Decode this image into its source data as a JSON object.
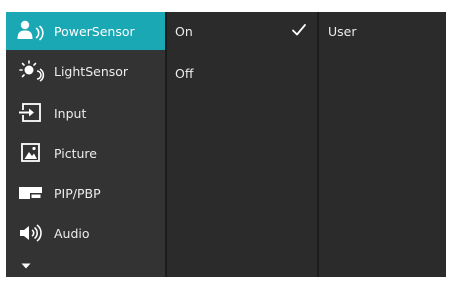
{
  "menu": {
    "items": [
      {
        "label": "PowerSensor",
        "icon": "power-sensor-icon",
        "active": true
      },
      {
        "label": "LightSensor",
        "icon": "light-sensor-icon",
        "active": false
      },
      {
        "label": "Input",
        "icon": "input-icon",
        "active": false
      },
      {
        "label": "Picture",
        "icon": "picture-icon",
        "active": false
      },
      {
        "label": "PIP/PBP",
        "icon": "pip-pbp-icon",
        "active": false
      },
      {
        "label": "Audio",
        "icon": "audio-icon",
        "active": false
      }
    ],
    "more_icon": "chevron-down-icon"
  },
  "options": {
    "items": [
      {
        "label": "On",
        "checked": true
      },
      {
        "label": "Off",
        "checked": false
      }
    ],
    "check_icon": "checkmark-icon"
  },
  "value": {
    "label": "User"
  },
  "colors": {
    "accent": "#19a8b4",
    "menu_bg": "#333333",
    "panel_bg": "#2b2b2b",
    "text": "#ededed"
  }
}
